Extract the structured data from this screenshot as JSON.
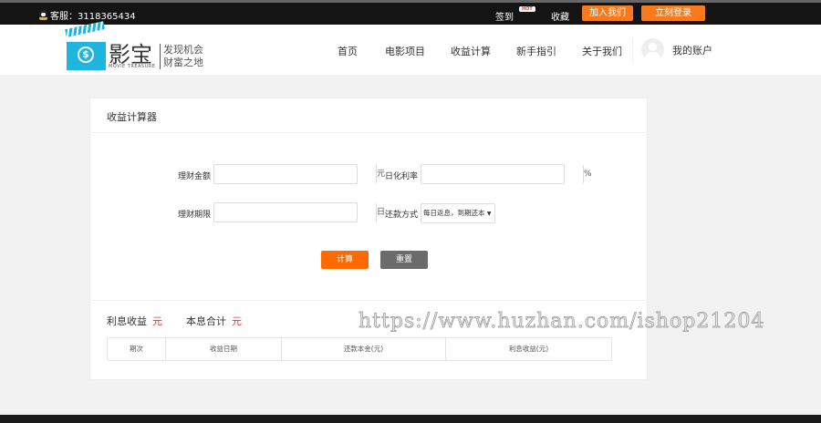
{
  "topbar": {
    "service_label": "客服：3118365434",
    "checkin": "签到",
    "hot": "HOT",
    "favorite": "收藏",
    "join": "加入我们",
    "login": "立刻登录"
  },
  "header": {
    "brand": "影宝",
    "brand_en": "MOVIE TREASURE",
    "slogan1": "发现机会",
    "slogan2": "财富之地",
    "nav": [
      "首页",
      "电影项目",
      "收益计算",
      "新手指引",
      "关于我们"
    ],
    "account": "我的账户"
  },
  "calculator": {
    "title": "收益计算器",
    "amount_label": "理财金额",
    "amount_value": "",
    "amount_unit": "元",
    "rate_label": "日化利率",
    "rate_value": "",
    "rate_unit": "%",
    "term_label": "理财期限",
    "term_value": "",
    "term_unit": "日",
    "method_label": "还款方式",
    "method_selected": "每日返息，到期还本",
    "calc_button": "计算",
    "reset_button": "重置"
  },
  "results": {
    "interest_label": "利息收益",
    "interest_unit": "元",
    "total_label": "本息合计",
    "total_unit": "元",
    "columns": [
      "期次",
      "收益日期",
      "还款本金(元)",
      "利息收益(元)"
    ]
  },
  "watermark": "https://www.huzhan.com/ishop21204",
  "colors": {
    "accent": "#f77a1c",
    "calc": "#ff6a00",
    "reset": "#6b6b6b"
  }
}
